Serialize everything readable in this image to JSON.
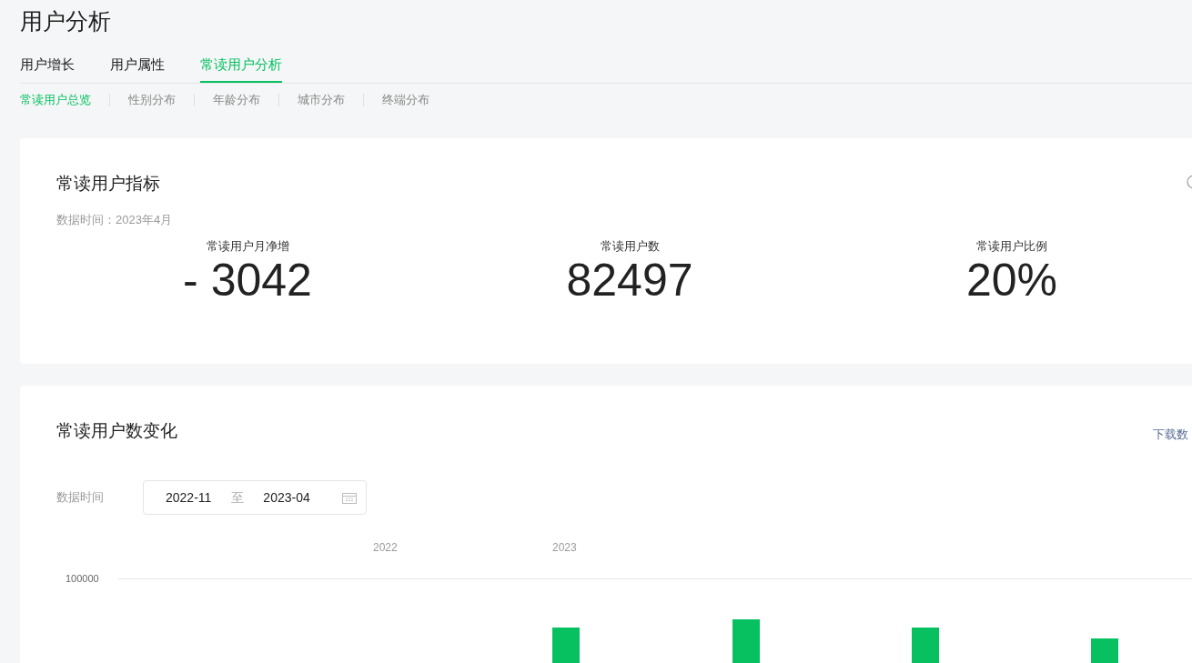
{
  "page_title": "用户分析",
  "tabs": [
    {
      "label": "用户增长",
      "selected": false
    },
    {
      "label": "用户属性",
      "selected": false
    },
    {
      "label": "常读用户分析",
      "selected": true
    }
  ],
  "subtabs": [
    {
      "label": "常读用户总览",
      "selected": true
    },
    {
      "label": "性别分布",
      "selected": false
    },
    {
      "label": "年龄分布",
      "selected": false
    },
    {
      "label": "城市分布",
      "selected": false
    },
    {
      "label": "终端分布",
      "selected": false
    }
  ],
  "metrics_card": {
    "title": "常读用户指标",
    "data_time": "数据时间：2023年4月",
    "metrics": [
      {
        "label": "常读用户月净增",
        "value": "- 3042"
      },
      {
        "label": "常读用户数",
        "value": "82497"
      },
      {
        "label": "常读用户比例",
        "value": "20%"
      }
    ]
  },
  "trend_card": {
    "title": "常读用户数变化",
    "download_link": "下载数",
    "date_label": "数据时间",
    "date_start": "2022-11",
    "date_separator": "至",
    "date_end": "2023-04",
    "year_labels": [
      "2022",
      "2023"
    ],
    "y_tick": "100000"
  }
}
